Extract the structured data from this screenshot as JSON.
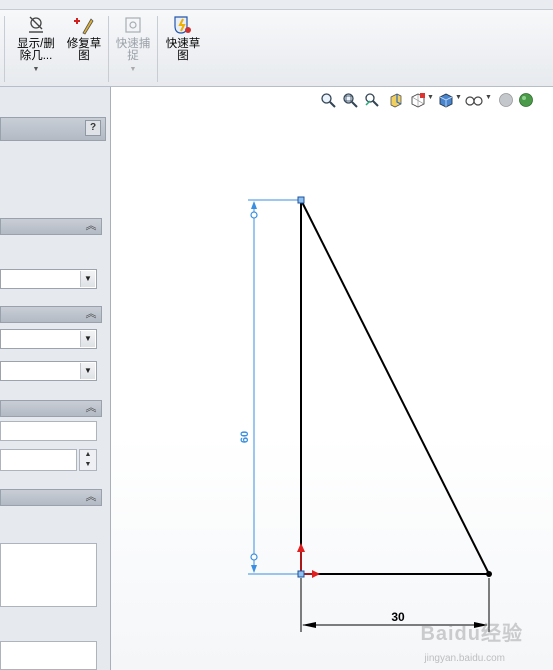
{
  "ribbon": {
    "buttons": [
      {
        "id": "display-delete-relations",
        "label_line1": "显示/删",
        "label_line2": "除几...",
        "has_arrow": true,
        "enabled": true
      },
      {
        "id": "repair-sketch",
        "label_line1": "修复草",
        "label_line2": "图",
        "has_arrow": false,
        "enabled": true
      },
      {
        "id": "quick-snaps",
        "label_line1": "快速捕",
        "label_line2": "捉",
        "has_arrow": true,
        "enabled": false
      },
      {
        "id": "rapid-sketch",
        "label_line1": "快速草",
        "label_line2": "图",
        "has_arrow": false,
        "enabled": true
      }
    ]
  },
  "panel": {
    "help_label": "?",
    "collapse_glyph": "«"
  },
  "view_toolbar": {
    "icons": [
      "zoom-to-fit-icon",
      "zoom-area-icon",
      "previous-view-icon",
      "section-view-icon",
      "view-orientation-icon",
      "display-style-icon",
      "hide-show-items-icon",
      "appearance-icon"
    ]
  },
  "sketch": {
    "vertical_dimension": "60",
    "horizontal_dimension": "30"
  },
  "watermark": {
    "brand": "Baidu经验",
    "url": "jingyan.baidu.com"
  },
  "colors": {
    "dimension_blue": "#3a8fe0",
    "sketch_line": "#000000",
    "origin_red": "#e02020",
    "endpoint_blue": "#3b7fd0"
  }
}
